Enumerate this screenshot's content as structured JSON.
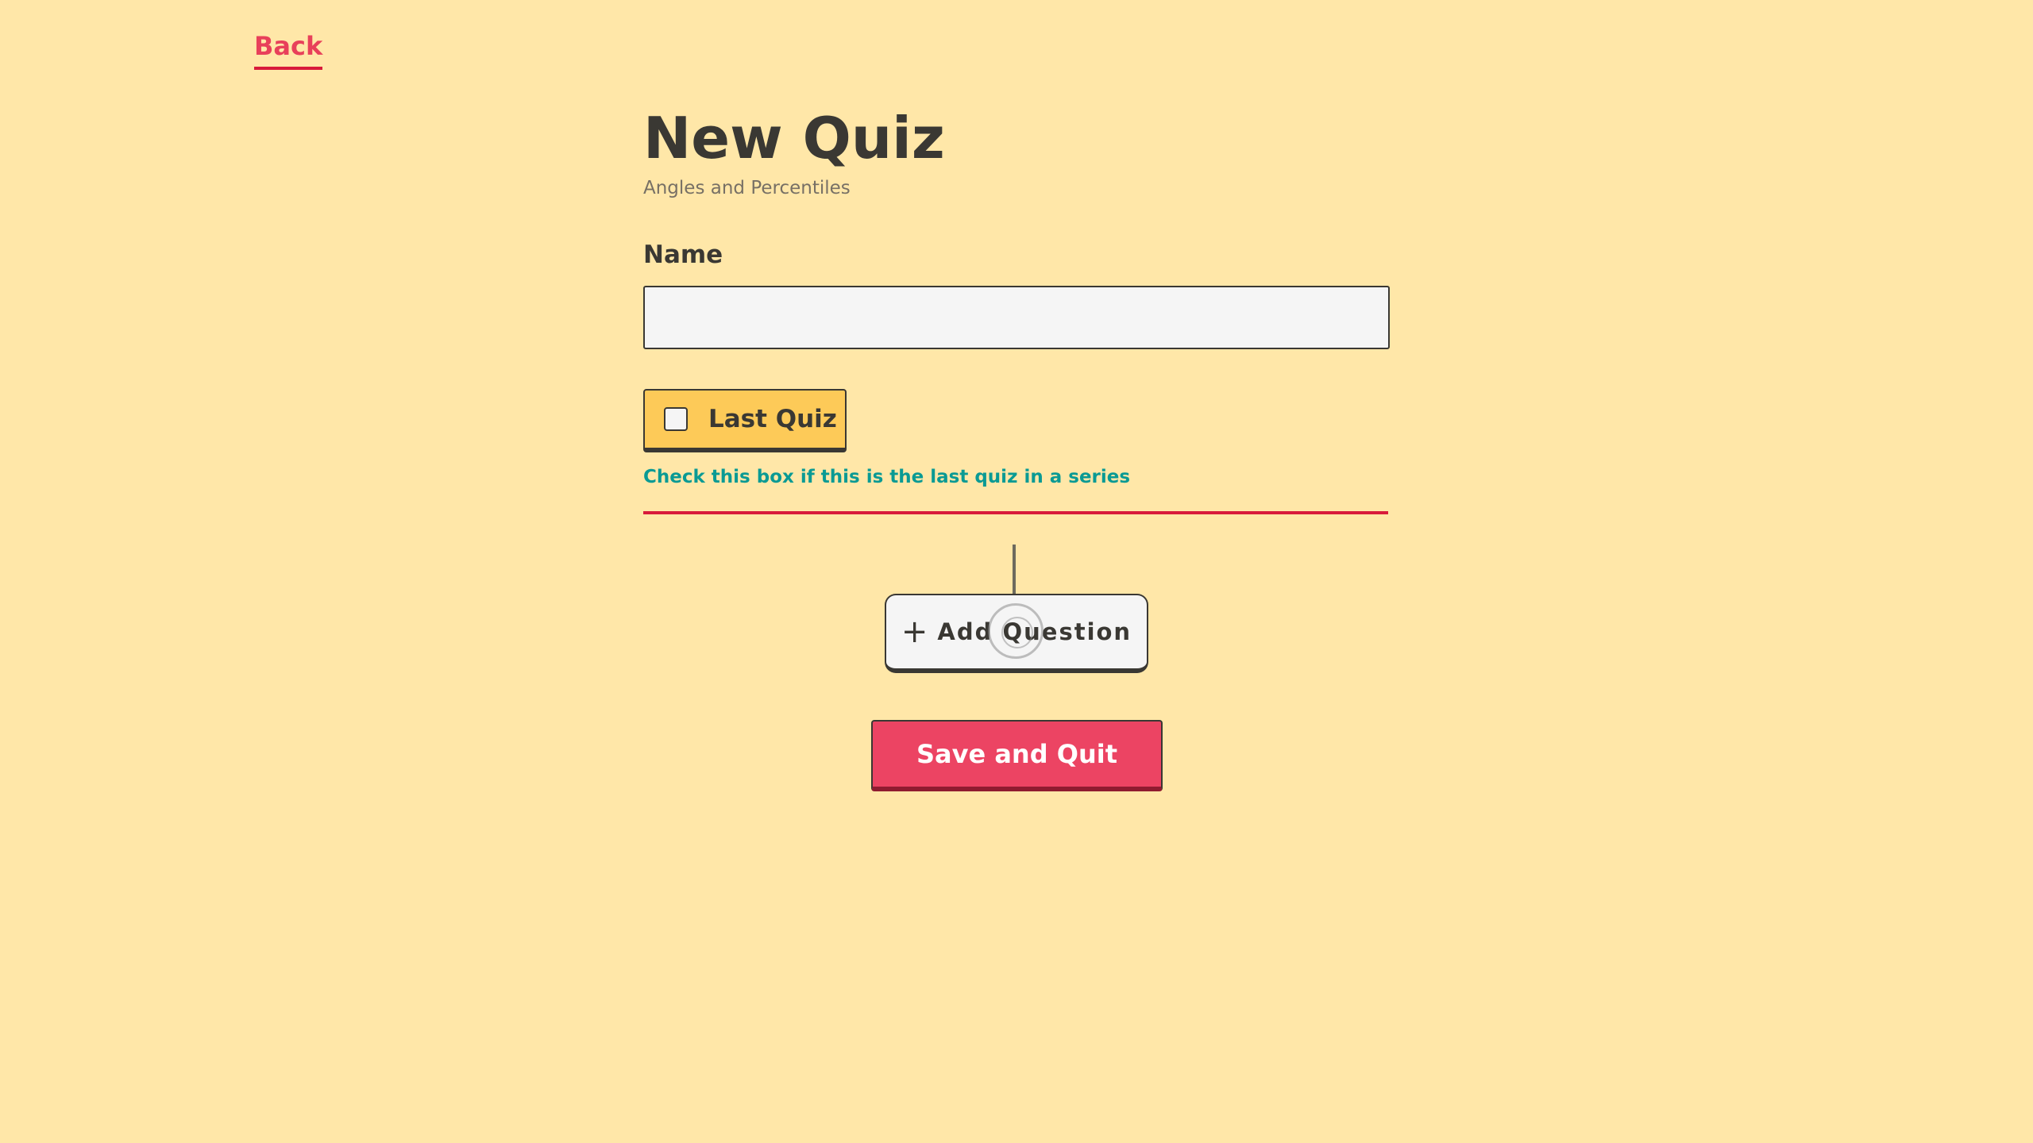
{
  "nav": {
    "back_label": "Back"
  },
  "header": {
    "title": "New Quiz",
    "subtitle": "Angles and Percentiles"
  },
  "form": {
    "name_label": "Name",
    "name_value": "",
    "name_placeholder": "",
    "last_quiz_label": "Last Quiz",
    "last_quiz_checked": false,
    "last_quiz_hint": "Check this box if this is the last quiz in a series"
  },
  "actions": {
    "add_question_label": "Add Question",
    "add_question_icon": "plus-icon",
    "save_label": "Save and Quit"
  },
  "colors": {
    "background": "#ffe7a8",
    "accent_red": "#ec4463",
    "divider_red": "#d81b3a",
    "checkbox_yellow": "#fdca58",
    "hint_teal": "#0a9a94"
  }
}
